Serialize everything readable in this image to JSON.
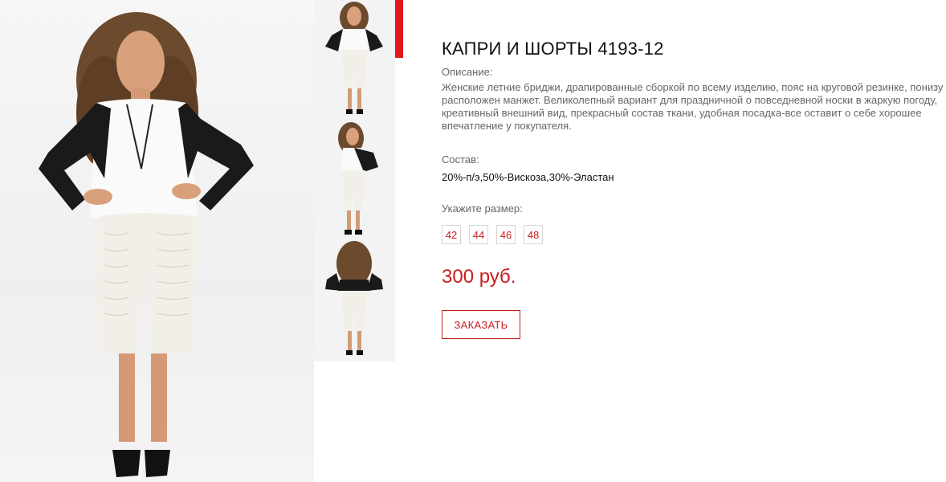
{
  "product": {
    "title": "КАПРИ И ШОРТЫ 4193-12",
    "description_label": "Описание:",
    "description": "Женские летние бриджи, драпированные сборкой по всему изделию, пояс на круговой резинке, понизу расположен манжет. Великолепный вариант для праздничной о повседневной носки в жаркую погоду, креативный внешний вид, прекрасный состав ткани, удобная посадка-все оставит о себе хорошее впечатление у покупателя.",
    "composition_label": "Состав:",
    "composition": "20%-п/э,50%-Вискоза,30%-Эластан",
    "size_label": "Укажите размер:",
    "sizes": [
      "42",
      "44",
      "46",
      "48"
    ],
    "price": "300 руб.",
    "order_label": "ЗАКАЗАТЬ"
  },
  "gallery": {
    "thumbnails": [
      "front-view",
      "side-view",
      "back-view"
    ],
    "active_thumbnail": 0
  },
  "colors": {
    "accent": "#e1181a",
    "price": "#c81d1d",
    "jacket": "#1a1a1a",
    "pants": "#f1efe8"
  }
}
